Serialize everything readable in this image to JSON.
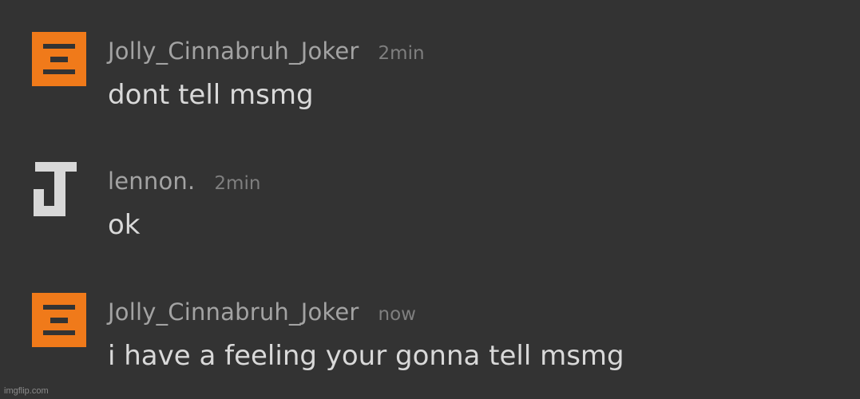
{
  "messages": [
    {
      "username": "Jolly_Cinnabruh_Joker",
      "time": "2min",
      "text": "dont tell msmg",
      "avatar_icon": "orange-h-logo-icon",
      "avatar_color": "#f07a1a"
    },
    {
      "username": "lennon.",
      "time": "2min",
      "text": "ok",
      "avatar_icon": "gray-j-logo-icon",
      "avatar_color": "#d8d8d8"
    },
    {
      "username": "Jolly_Cinnabruh_Joker",
      "time": "now",
      "text": "i have a feeling your gonna tell msmg",
      "avatar_icon": "orange-h-logo-icon",
      "avatar_color": "#f07a1a"
    }
  ],
  "watermark": "imgflip.com",
  "colors": {
    "background": "#333333",
    "username": "#a3a3a3",
    "timestamp": "#7f7f7f",
    "message_text": "#d9d9d9"
  }
}
